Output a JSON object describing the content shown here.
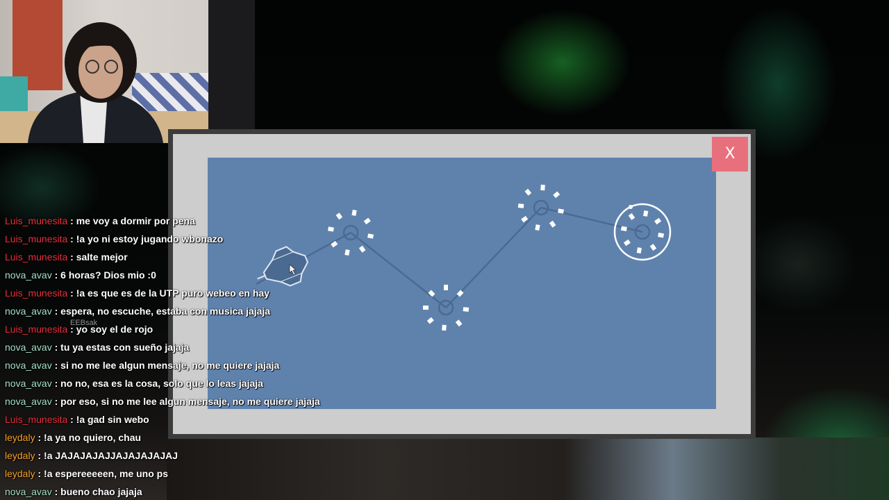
{
  "overlay": {
    "close_label": "X",
    "ghost_label": "EEBsak"
  },
  "colors": {
    "board": "#5f82ad",
    "panel": "#cdcdcd",
    "close_button": "#e8707c",
    "user_red": "#e8303e",
    "user_teal": "#a6e0c8",
    "user_orange": "#f5a42d"
  },
  "game": {
    "nodes": [
      "node-1",
      "node-2",
      "node-3",
      "node-4",
      "node-goal"
    ],
    "player": "ship-icon"
  },
  "chat": {
    "messages": [
      {
        "user": "Luis_munesita",
        "text": ": me voy a dormir por pena",
        "color": "#e8303e"
      },
      {
        "user": "Luis_munesita",
        "text": ": !a yo ni estoy jugando wbonazo",
        "color": "#e8303e"
      },
      {
        "user": "Luis_munesita",
        "text": ": salte mejor",
        "color": "#e8303e"
      },
      {
        "user": "nova_avav",
        "text": ": 6 horas? Dios mio :0",
        "color": "#a6e0c8"
      },
      {
        "user": "Luis_munesita",
        "text": ": !a es que es de la UTP puro webeo en hay",
        "color": "#e8303e"
      },
      {
        "user": "nova_avav",
        "text": ": espera, no escuche, estaba con musica jajaja",
        "color": "#a6e0c8"
      },
      {
        "user": "Luis_munesita",
        "text": ": yo soy el de rojo",
        "color": "#e8303e"
      },
      {
        "user": "nova_avav",
        "text": ": tu ya estas con sueño jajaja",
        "color": "#a6e0c8"
      },
      {
        "user": "nova_avav",
        "text": ": si no me lee algun mensaje, no me quiere jajaja",
        "color": "#a6e0c8"
      },
      {
        "user": "nova_avav",
        "text": ": no no, esa es la cosa, solo que lo leas jajaja",
        "color": "#a6e0c8"
      },
      {
        "user": "nova_avav",
        "text": ": por eso, si no me lee algun mensaje, no me quiere jajaja",
        "color": "#a6e0c8"
      },
      {
        "user": "Luis_munesita",
        "text": ": !a gad sin webo",
        "color": "#e8303e"
      },
      {
        "user": "leydaly",
        "text": ": !a ya no quiero, chau",
        "color": "#f5a42d"
      },
      {
        "user": "leydaly",
        "text": ": !a JAJAJAJAJJAJAJAJAJAJ",
        "color": "#f5a42d"
      },
      {
        "user": "leydaly",
        "text": ": !a espereeeeen, me uno ps",
        "color": "#f5a42d"
      },
      {
        "user": "nova_avav",
        "text": ": bueno chao jajaja",
        "color": "#a6e0c8"
      }
    ]
  }
}
